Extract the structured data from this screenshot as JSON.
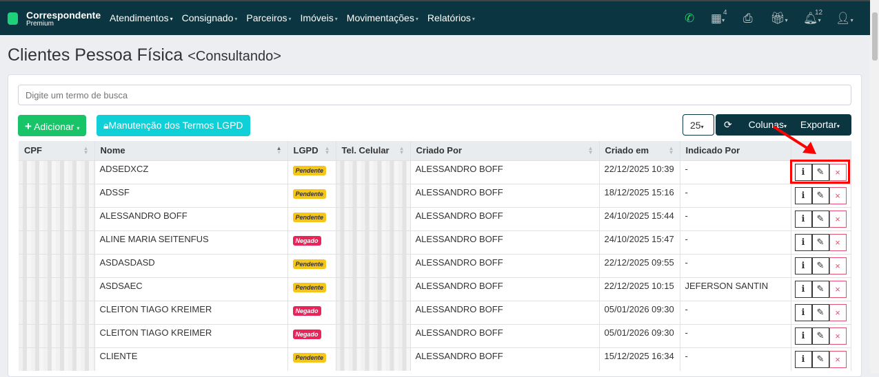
{
  "nav": {
    "brand": "Correspondente",
    "sub": "Premium",
    "menu": [
      "Atendimentos",
      "Consignado",
      "Parceiros",
      "Imóveis",
      "Movimentações",
      "Relatórios"
    ],
    "calendar_count": "4",
    "notif_count": "12"
  },
  "page": {
    "title": "Clientes Pessoa Física",
    "mode": "<Consultando>"
  },
  "search": {
    "placeholder": "Digite um termo de busca"
  },
  "toolbar": {
    "add": "Adicionar",
    "lgpd": "Manutenção dos Termos LGPD",
    "page_size": "25",
    "columns": "Colunas",
    "export": "Exportar"
  },
  "table": {
    "headers": [
      "CPF",
      "Nome",
      "LGPD",
      "Tel. Celular",
      "Criado Por",
      "Criado em",
      "Indicado Por"
    ],
    "rows": [
      {
        "nome": "ADSEDXCZ",
        "lgpd": "Pendente",
        "criado_por": "ALESSANDRO BOFF",
        "criado_em": "22/12/2025 10:39",
        "indicado": "-"
      },
      {
        "nome": "ADSSF",
        "lgpd": "Pendente",
        "criado_por": "ALESSANDRO BOFF",
        "criado_em": "18/12/2025 15:16",
        "indicado": "-"
      },
      {
        "nome": "ALESSANDRO BOFF",
        "lgpd": "Pendente",
        "criado_por": "ALESSANDRO BOFF",
        "criado_em": "24/10/2025 15:44",
        "indicado": "-"
      },
      {
        "nome": "ALINE MARIA SEITENFUS",
        "lgpd": "Negado",
        "criado_por": "ALESSANDRO BOFF",
        "criado_em": "24/10/2025 15:47",
        "indicado": "-"
      },
      {
        "nome": "ASDASDASD",
        "lgpd": "Pendente",
        "criado_por": "ALESSANDRO BOFF",
        "criado_em": "22/12/2025 09:55",
        "indicado": "-"
      },
      {
        "nome": "ASDSAEC",
        "lgpd": "Pendente",
        "criado_por": "ALESSANDRO BOFF",
        "criado_em": "22/12/2025 10:15",
        "indicado": "JEFERSON SANTIN"
      },
      {
        "nome": "CLEITON TIAGO KREIMER",
        "lgpd": "Negado",
        "criado_por": "ALESSANDRO BOFF",
        "criado_em": "05/01/2026 09:30",
        "indicado": "-"
      },
      {
        "nome": "CLEITON TIAGO KREIMER",
        "lgpd": "Negado",
        "criado_por": "ALESSANDRO BOFF",
        "criado_em": "05/01/2026 09:30",
        "indicado": "-"
      },
      {
        "nome": "CLIENTE",
        "lgpd": "Pendente",
        "criado_por": "ALESSANDRO BOFF",
        "criado_em": "15/12/2025 16:34",
        "indicado": "-"
      }
    ]
  },
  "colors": {
    "Pendente": "#f5c518",
    "Negado": "#e8245a"
  }
}
